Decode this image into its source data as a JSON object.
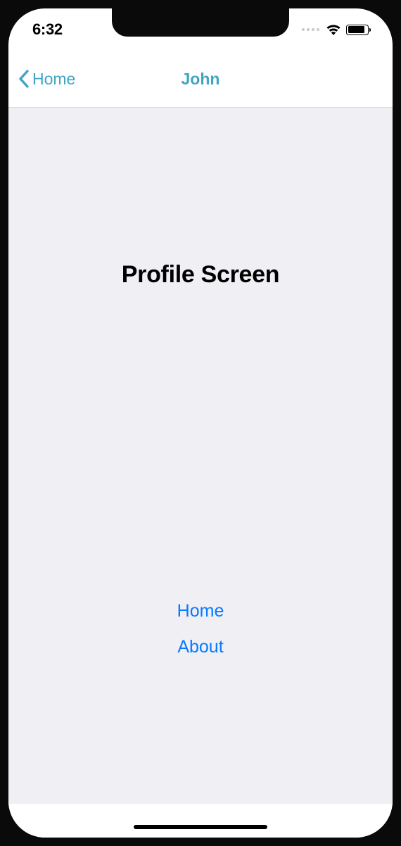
{
  "status": {
    "time": "6:32"
  },
  "nav": {
    "back_label": "Home",
    "title": "John"
  },
  "content": {
    "headline": "Profile Screen",
    "links": [
      "Home",
      "About"
    ]
  },
  "accent_color": "#3fa5c3",
  "link_color": "#0a7aff"
}
